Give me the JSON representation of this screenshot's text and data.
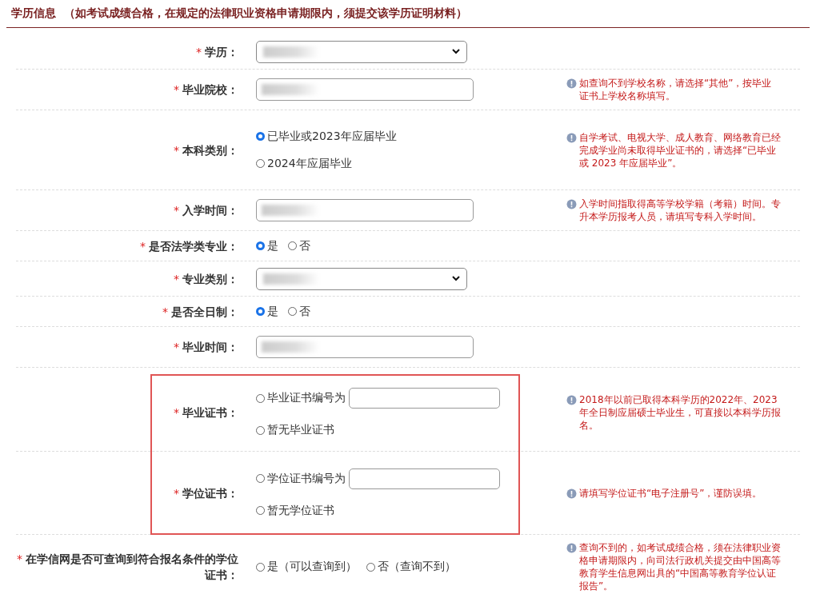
{
  "section": {
    "title": "学历信息",
    "note": "（如考试成绩合格，在规定的法律职业资格申请期限内，须提交该学历证明材料）"
  },
  "fields": [
    {
      "kind": "select",
      "label": "学历：",
      "marker": "*",
      "redacted": true,
      "highlighted": false
    },
    {
      "kind": "text",
      "label": "毕业院校：",
      "marker": "*",
      "redacted": true,
      "highlighted": false,
      "hint": "如查询不到学校名称，请选择“其他”，按毕业证书上学校名称填写。"
    },
    {
      "kind": "radio-stack",
      "label": "本科类别：",
      "marker": "*",
      "highlighted": false,
      "options": [
        {
          "label": "已毕业或2023年应届毕业",
          "selected": true
        },
        {
          "label": "2024年应届毕业",
          "selected": false
        }
      ],
      "hint": "自学考试、电视大学、成人教育、网络教育已经完成学业尚未取得毕业证书的，请选择“已毕业或 2023 年应届毕业”。"
    },
    {
      "kind": "text",
      "label": "入学时间：",
      "marker": "*",
      "redacted": true,
      "highlighted": false,
      "hint": "入学时间指取得高等学校学籍（考籍）时间。专升本学历报考人员，请填写专科入学时间。"
    },
    {
      "kind": "radio-inline",
      "label": "是否法学类专业：",
      "marker": "*",
      "highlighted": false,
      "options": [
        {
          "label": "是",
          "selected": true
        },
        {
          "label": "否",
          "selected": false
        }
      ]
    },
    {
      "kind": "select",
      "label": "专业类别：",
      "marker": "*",
      "redacted": true,
      "highlighted": false
    },
    {
      "kind": "radio-inline",
      "label": "是否全日制：",
      "marker": "*",
      "highlighted": false,
      "options": [
        {
          "label": "是",
          "selected": true
        },
        {
          "label": "否",
          "selected": false
        }
      ]
    },
    {
      "kind": "text",
      "label": "毕业时间：",
      "marker": "*",
      "redacted": true,
      "highlighted": false
    },
    {
      "kind": "cert",
      "label": "毕业证书：",
      "marker": "*",
      "highlighted": true,
      "options": [
        {
          "label": "毕业证书编号为",
          "selected": false,
          "has_input": true
        },
        {
          "label": "暂无毕业证书",
          "selected": false,
          "has_input": false
        }
      ],
      "hint": "2018年以前已取得本科学历的2022年、2023年全日制应届硕士毕业生，可直接以本科学历报名。"
    },
    {
      "kind": "cert",
      "label": "学位证书：",
      "marker": "*",
      "highlighted": true,
      "options": [
        {
          "label": "学位证书编号为",
          "selected": false,
          "has_input": true
        },
        {
          "label": "暂无学位证书",
          "selected": false,
          "has_input": false
        }
      ],
      "hint": "请填写学位证书“电子注册号”，谨防误填。"
    },
    {
      "kind": "radio-inline",
      "label": "在学信网是否可查询到符合报名条件的学位证书：",
      "marker": "*",
      "highlighted": false,
      "options": [
        {
          "label": "是（可以查询到）",
          "selected": false
        },
        {
          "label": "否（查询不到）",
          "selected": false
        }
      ],
      "hint": "查询不到的，如考试成绩合格，须在法律职业资格申请期限内，向司法行政机关提交由中国高等教育学生信息网出具的“中国高等教育学位认证报告”。"
    }
  ]
}
